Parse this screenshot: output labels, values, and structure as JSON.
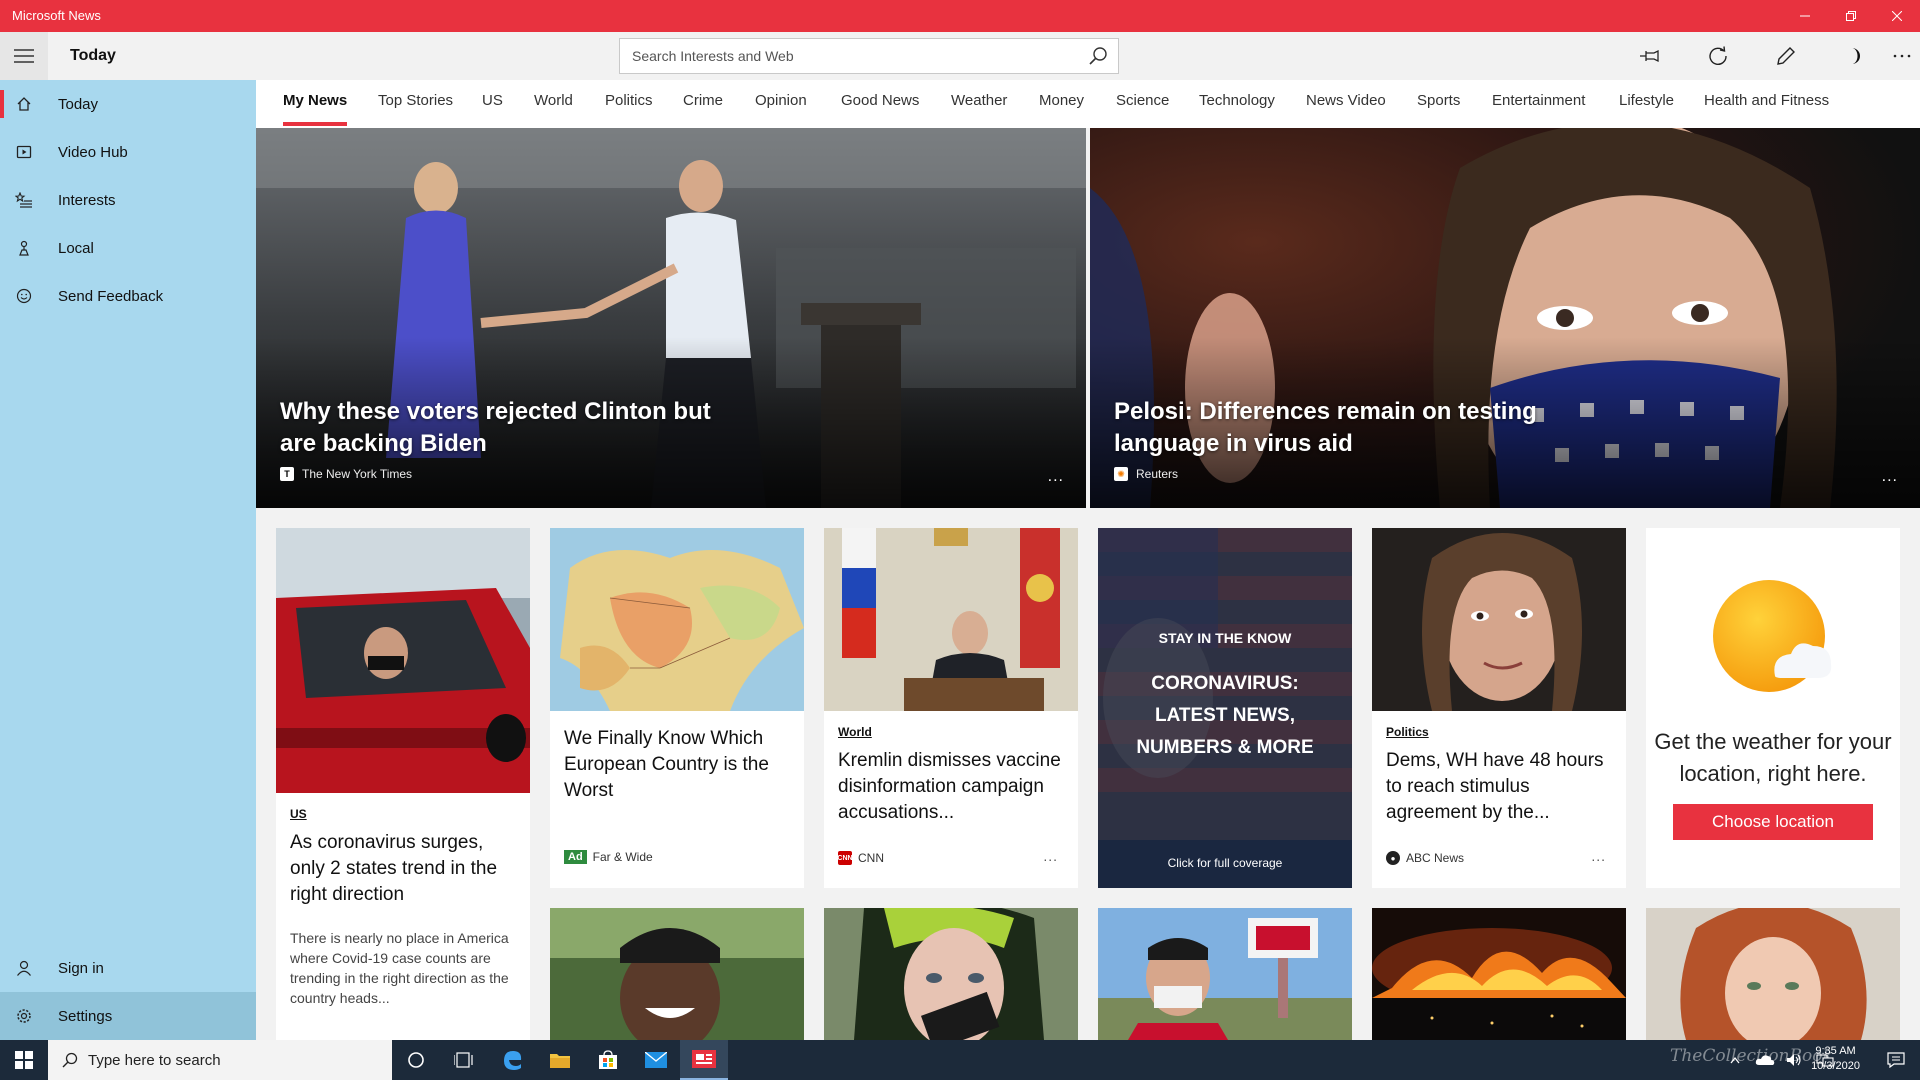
{
  "window": {
    "title": "Microsoft News",
    "controls": [
      "minimize",
      "restore",
      "close"
    ]
  },
  "sidebar": {
    "menu_icon": "hamburger-icon",
    "header": "Today",
    "items": [
      {
        "label": "Today",
        "icon": "home-icon",
        "active": true
      },
      {
        "label": "Video Hub",
        "icon": "video-icon"
      },
      {
        "label": "Interests",
        "icon": "interests-icon"
      },
      {
        "label": "Local",
        "icon": "location-icon"
      },
      {
        "label": "Send Feedback",
        "icon": "smiley-icon"
      }
    ],
    "bottom_items": [
      {
        "label": "Sign in",
        "icon": "person-icon"
      },
      {
        "label": "Settings",
        "icon": "gear-icon"
      }
    ]
  },
  "search": {
    "placeholder": "Search Interests and Web"
  },
  "toolbar_icons": [
    "pin-icon",
    "refresh-icon",
    "edit-icon",
    "dark-mode-icon",
    "more-icon"
  ],
  "tabs": [
    "My News",
    "Top Stories",
    "US",
    "World",
    "Politics",
    "Crime",
    "Opinion",
    "Good News",
    "Weather",
    "Money",
    "Science",
    "Technology",
    "News Video",
    "Sports",
    "Entertainment",
    "Lifestyle",
    "Health and Fitness"
  ],
  "active_tab": "My News",
  "heroes": [
    {
      "title": "Why these voters rejected Clinton but are backing Biden",
      "source": "The New York Times",
      "more": "..."
    },
    {
      "title": "Pelosi: Differences remain on testing language in virus aid",
      "source": "Reuters",
      "more": "..."
    }
  ],
  "cards": [
    {
      "category": "US",
      "title": "As coronavirus surges, only 2 states trend in the right direction",
      "body": "There is nearly no place in America where Covid-19 case counts are trending in the right direction as the country heads..."
    },
    {
      "title": "We Finally Know Which European Country is the Worst",
      "ad_label": "Ad",
      "source": "Far & Wide"
    },
    {
      "category": "World",
      "title": "Kremlin dismisses vaccine disinformation campaign accusations...",
      "source": "CNN",
      "more": "..."
    },
    {
      "kicker": "STAY IN THE KNOW",
      "headline": "CORONAVIRUS: LATEST NEWS, NUMBERS & MORE",
      "footer": "Click for full coverage"
    },
    {
      "category": "Politics",
      "title": "Dems, WH have 48 hours to reach stimulus agreement by the...",
      "source": "ABC News",
      "more": "..."
    },
    {
      "title": "Get the weather for your location, right here.",
      "button": "Choose location"
    }
  ],
  "taskbar": {
    "search_placeholder": "Type here to search",
    "time": "9:35 AM",
    "date": "10/3/2020",
    "watermark": "TheCollectionBook"
  },
  "colors": {
    "accent": "#e8323f",
    "sidebar_bg": "#a8d8ee",
    "taskbar_bg": "#1c2a3a"
  }
}
